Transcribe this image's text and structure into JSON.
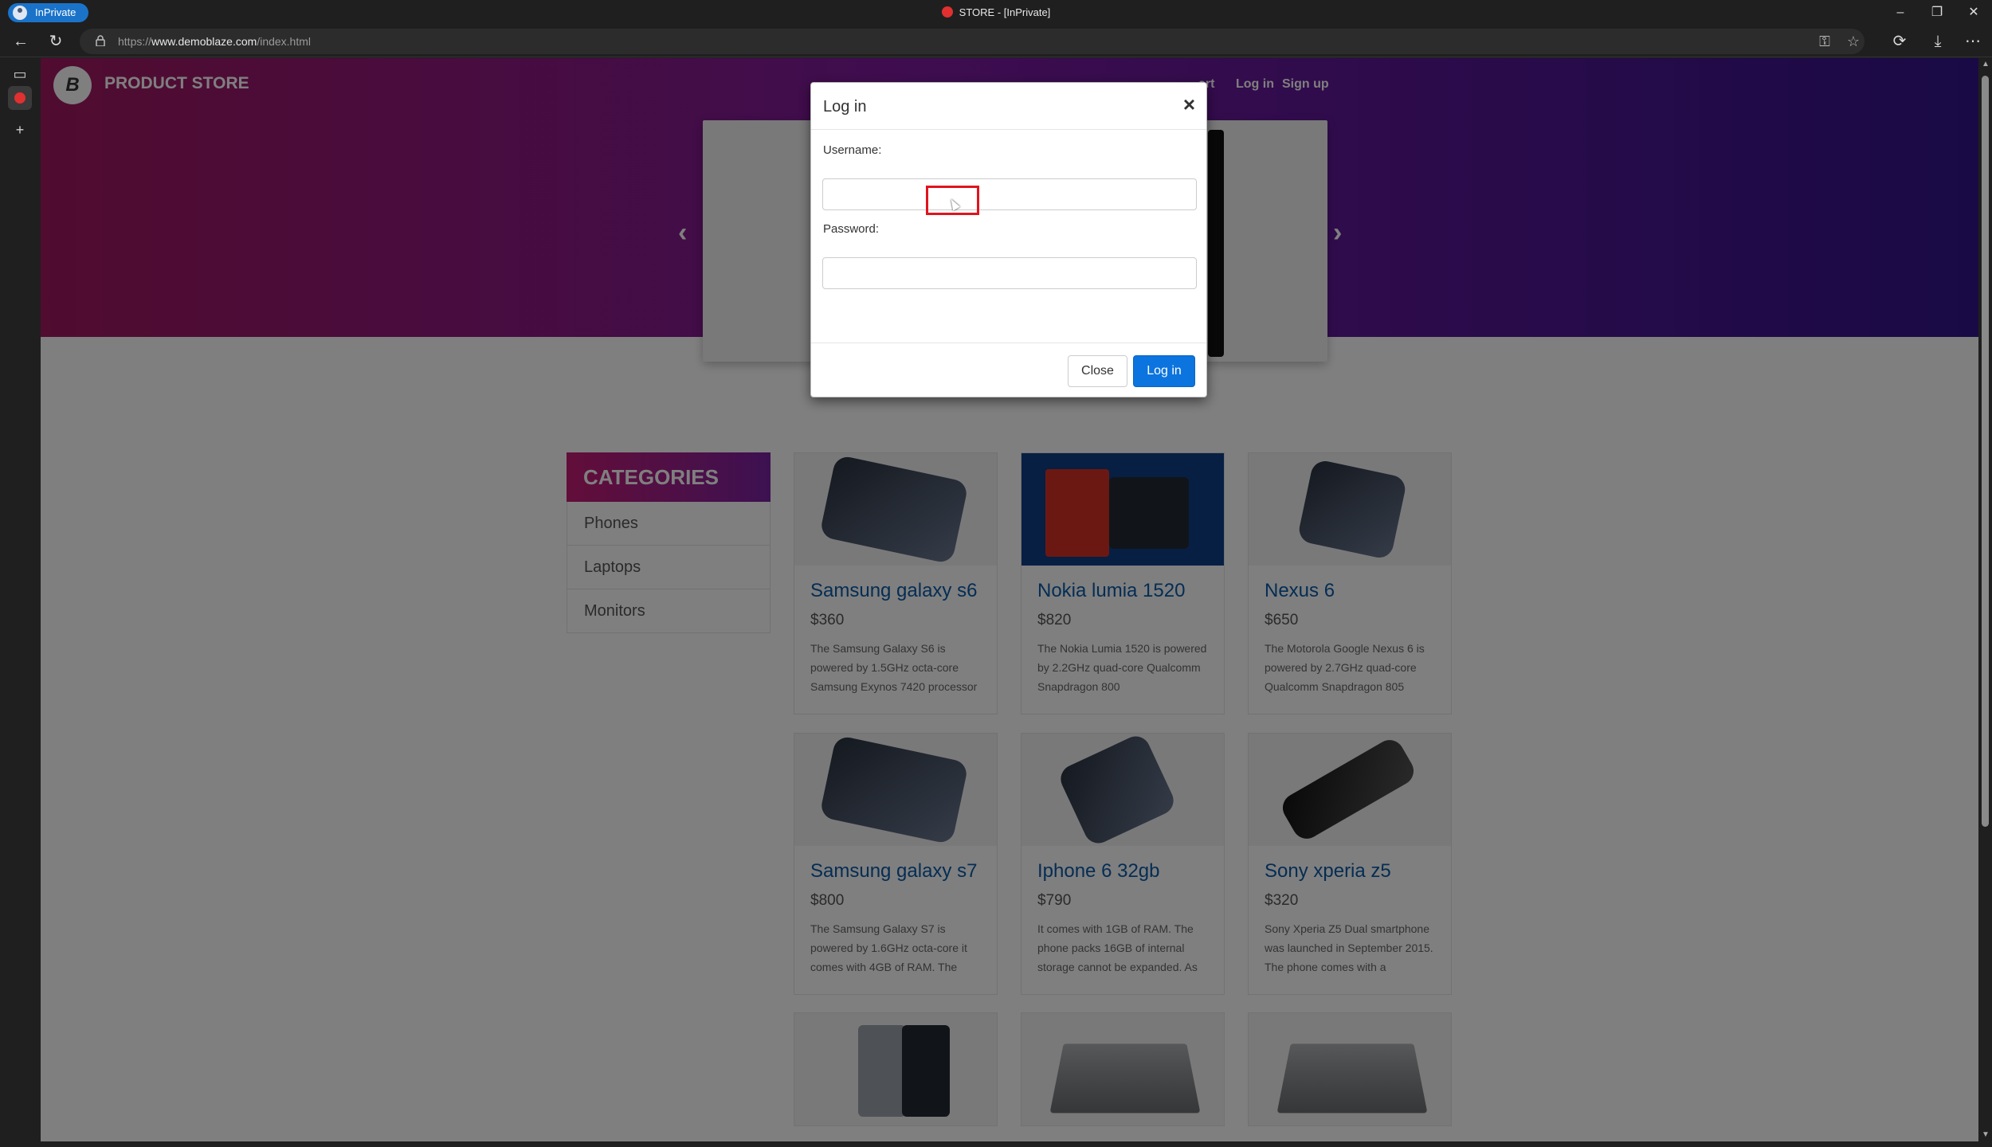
{
  "browser": {
    "inprivate_label": "InPrivate",
    "window_title": "STORE - [InPrivate]",
    "url_prefix": "https://",
    "url_domain": "www.demoblaze.com",
    "url_path": "/index.html"
  },
  "site": {
    "brand": "PRODUCT STORE",
    "logo_text": "B",
    "nav": {
      "cart": "art",
      "login": "Log in",
      "signup": "Sign up"
    }
  },
  "categories": {
    "title": "CATEGORIES",
    "items": [
      "Phones",
      "Laptops",
      "Monitors"
    ]
  },
  "products": [
    {
      "name": "Samsung galaxy s6",
      "price": "$360",
      "desc": "The Samsung Galaxy S6 is powered by 1.5GHz octa-core Samsung Exynos 7420 processor"
    },
    {
      "name": "Nokia lumia 1520",
      "price": "$820",
      "desc": "The Nokia Lumia 1520 is powered by 2.2GHz quad-core Qualcomm Snapdragon 800"
    },
    {
      "name": "Nexus 6",
      "price": "$650",
      "desc": "The Motorola Google Nexus 6 is powered by 2.7GHz quad-core Qualcomm Snapdragon 805"
    },
    {
      "name": "Samsung galaxy s7",
      "price": "$800",
      "desc": "The Samsung Galaxy S7 is powered by 1.6GHz octa-core it comes with 4GB of RAM. The"
    },
    {
      "name": "Iphone 6 32gb",
      "price": "$790",
      "desc": "It comes with 1GB of RAM. The phone packs 16GB of internal storage cannot be expanded. As"
    },
    {
      "name": "Sony xperia z5",
      "price": "$320",
      "desc": "Sony Xperia Z5 Dual smartphone was launched in September 2015. The phone comes with a"
    }
  ],
  "modal": {
    "title": "Log in",
    "close_x": "×",
    "username_label": "Username:",
    "username_value": "",
    "password_label": "Password:",
    "password_value": "",
    "close_button": "Close",
    "login_button": "Log in"
  },
  "colors": {
    "hero_start": "#a2195f",
    "hero_end": "#32148c",
    "link": "#0b5aa8",
    "primary_button": "#0b74de",
    "highlight": "#e0141e"
  }
}
